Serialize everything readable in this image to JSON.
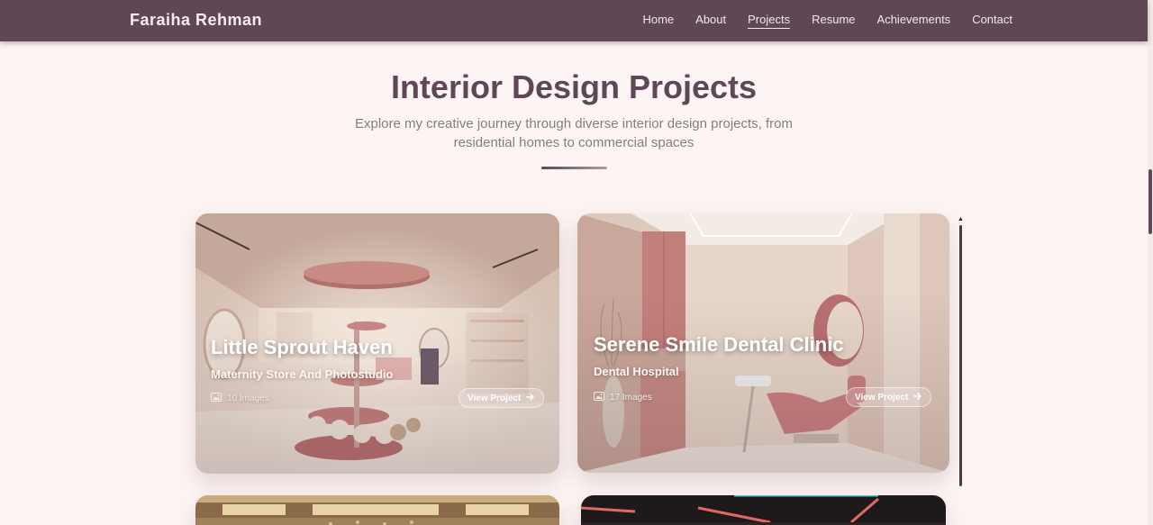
{
  "nav": {
    "brand": "Faraiha Rehman",
    "links": [
      {
        "label": "Home"
      },
      {
        "label": "About"
      },
      {
        "label": "Projects",
        "active": true
      },
      {
        "label": "Resume"
      },
      {
        "label": "Achievements"
      },
      {
        "label": "Contact"
      }
    ]
  },
  "header": {
    "title": "Interior Design Projects",
    "subtitle": "Explore my creative journey through diverse interior design projects, from residential homes to commercial spaces"
  },
  "projects": [
    {
      "title": "Little Sprout Haven",
      "subtitle": "Maternity Store And Photostudio",
      "count": "10 Images",
      "button": "View Project",
      "image_icon": "image-icon",
      "arrow_icon": "arrow-right-icon"
    },
    {
      "title": "Serene Smile Dental Clinic",
      "subtitle": "Dental Hospital",
      "count": "17 Images",
      "button": "View Project",
      "image_icon": "image-icon",
      "arrow_icon": "arrow-right-icon"
    }
  ],
  "colors": {
    "nav_bg": "#5f4756",
    "page_bg": "#fdf5f3",
    "accent": "#5f4756",
    "subtitle_text": "#8a7a80"
  }
}
